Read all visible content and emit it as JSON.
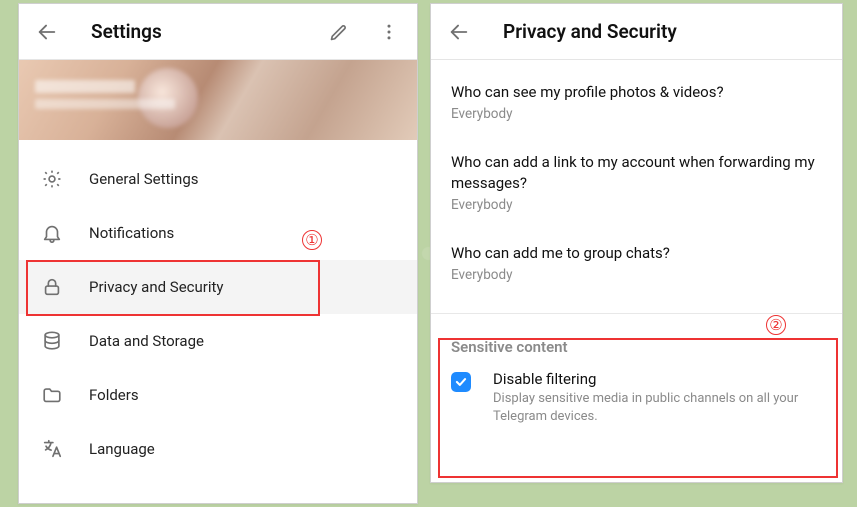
{
  "annotations": {
    "step1": "①",
    "step2": "②"
  },
  "left": {
    "title": "Settings",
    "menu": [
      {
        "key": "general",
        "label": "General Settings"
      },
      {
        "key": "notif",
        "label": "Notifications"
      },
      {
        "key": "privacy",
        "label": "Privacy and Security",
        "active": true
      },
      {
        "key": "data",
        "label": "Data and Storage"
      },
      {
        "key": "folders",
        "label": "Folders"
      },
      {
        "key": "lang",
        "label": "Language"
      }
    ]
  },
  "right": {
    "title": "Privacy and Security",
    "privacy_items": [
      {
        "title": "Who can see my profile photos & videos?",
        "value": "Everybody"
      },
      {
        "title": "Who can add a link to my account when forwarding my messages?",
        "value": "Everybody"
      },
      {
        "title": "Who can add me to group chats?",
        "value": "Everybody"
      }
    ],
    "sensitive": {
      "header": "Sensitive content",
      "option_title": "Disable filtering",
      "option_desc": "Display sensitive media in public channels on all your Telegram devices.",
      "checked": true
    }
  }
}
